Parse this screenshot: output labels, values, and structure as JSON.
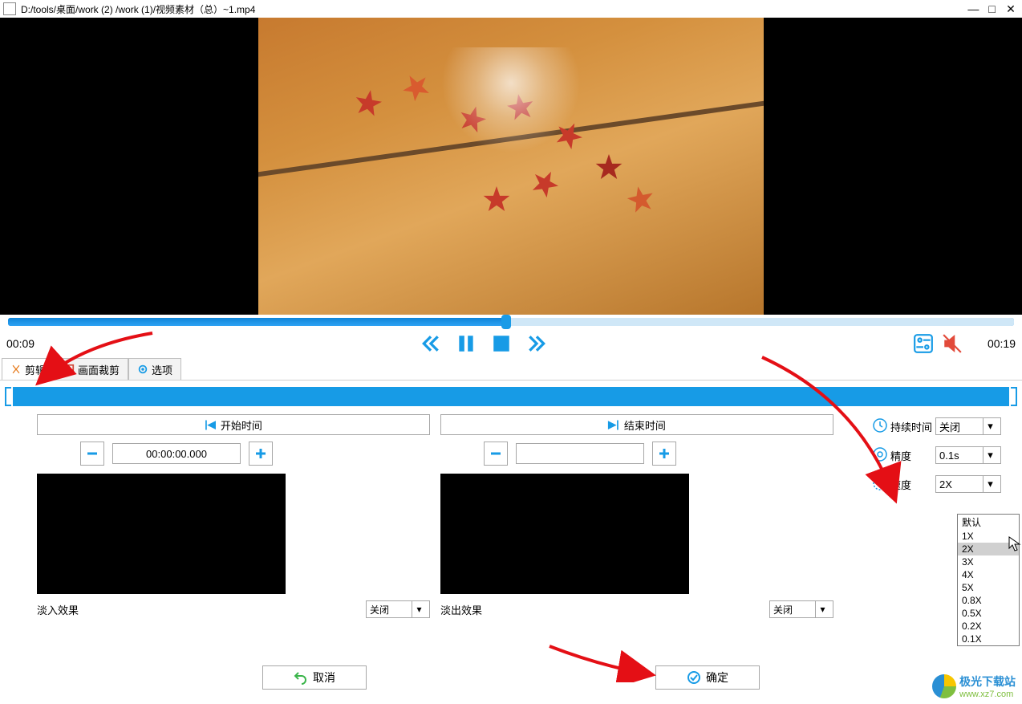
{
  "title": "D:/tools/桌面/work (2) /work (1)/视频素材（总）~1.mp4",
  "time": {
    "current": "00:09",
    "total": "00:19"
  },
  "tabs": [
    {
      "label": "剪辑",
      "active": true
    },
    {
      "label": "画面裁剪",
      "active": false
    },
    {
      "label": "选项",
      "active": false
    }
  ],
  "startTime": {
    "btn": "开始时间",
    "value": "00:00:00.000"
  },
  "endTime": {
    "btn": "结束时间",
    "value": ""
  },
  "fadeIn": {
    "label": "淡入效果",
    "value": "关闭"
  },
  "fadeOut": {
    "label": "淡出效果",
    "value": "关闭"
  },
  "duration": {
    "label": "持续时间",
    "value": "关闭"
  },
  "precision": {
    "label": "精度",
    "value": "0.1s"
  },
  "speed": {
    "label": "速度",
    "value": "2X",
    "options": [
      "默认",
      "1X",
      "2X",
      "3X",
      "4X",
      "5X",
      "0.8X",
      "0.5X",
      "0.2X",
      "0.1X"
    ]
  },
  "buttons": {
    "cancel": "取消",
    "ok": "确定"
  },
  "logo": {
    "name": "极光下载站",
    "url": "www.xz7.com"
  }
}
